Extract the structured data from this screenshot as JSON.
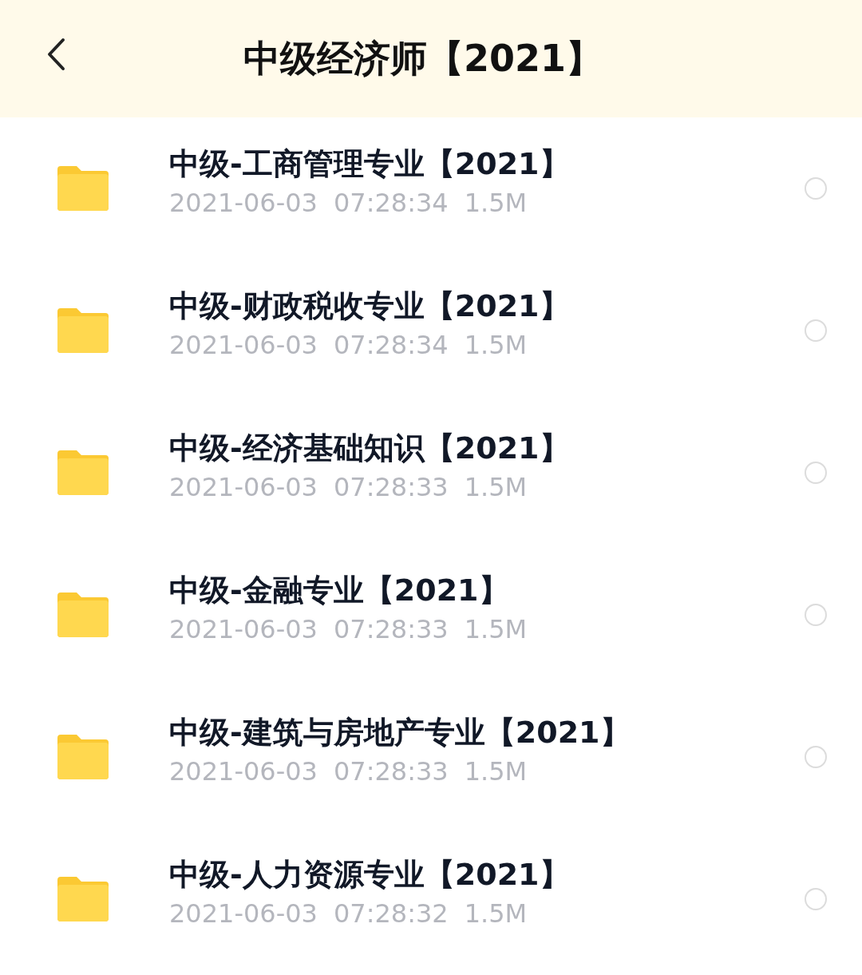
{
  "header": {
    "title": "中级经济师【2021】"
  },
  "files": [
    {
      "name": "中级-工商管理专业【2021】",
      "date": "2021-06-03",
      "time": "07:28:34",
      "size": "1.5M",
      "selected": false
    },
    {
      "name": "中级-财政税收专业【2021】",
      "date": "2021-06-03",
      "time": "07:28:34",
      "size": "1.5M",
      "selected": false
    },
    {
      "name": "中级-经济基础知识【2021】",
      "date": "2021-06-03",
      "time": "07:28:33",
      "size": "1.5M",
      "selected": false
    },
    {
      "name": "中级-金融专业【2021】",
      "date": "2021-06-03",
      "time": "07:28:33",
      "size": "1.5M",
      "selected": false
    },
    {
      "name": "中级-建筑与房地产专业【2021】",
      "date": "2021-06-03",
      "time": "07:28:33",
      "size": "1.5M",
      "selected": false
    },
    {
      "name": "中级-人力资源专业【2021】",
      "date": "2021-06-03",
      "time": "07:28:32",
      "size": "1.5M",
      "selected": false
    }
  ]
}
